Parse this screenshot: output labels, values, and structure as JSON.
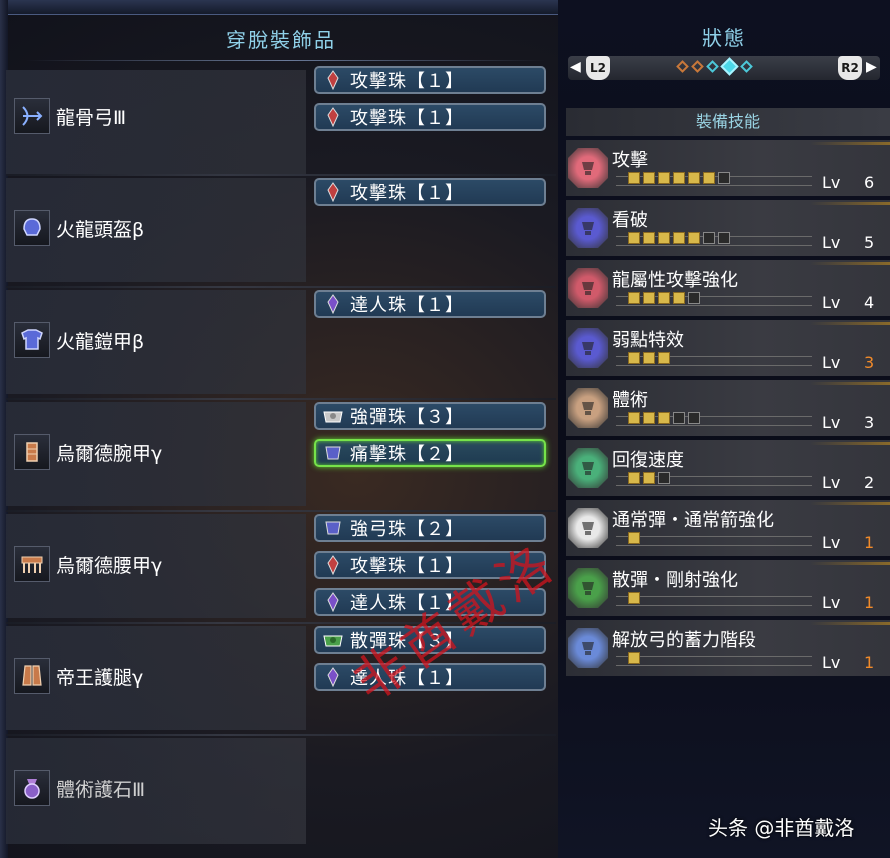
{
  "left_title": "穿脫裝飾品",
  "right_title": "狀態",
  "nav": {
    "left_button": "L2",
    "right_button": "R2",
    "left_arrow": "◀",
    "right_arrow": "▶"
  },
  "skills_header": "裝備技能",
  "lv_label": "Lv",
  "equipment": [
    {
      "name": "龍骨弓Ⅲ",
      "icon": "bow-icon",
      "decorations": [
        "攻擊珠【１】",
        "攻擊珠【１】"
      ]
    },
    {
      "name": "火龍頭盔β",
      "icon": "helm-icon",
      "decorations": [
        "攻擊珠【１】"
      ]
    },
    {
      "name": "火龍鎧甲β",
      "icon": "chest-armor-icon",
      "decorations": [
        "達人珠【１】"
      ]
    },
    {
      "name": "烏爾德腕甲γ",
      "icon": "arm-armor-icon",
      "decorations": [
        "強彈珠【３】",
        "痛擊珠【２】"
      ]
    },
    {
      "name": "烏爾德腰甲γ",
      "icon": "waist-armor-icon",
      "decorations": [
        "強弓珠【２】",
        "攻擊珠【１】",
        "達人珠【１】"
      ]
    },
    {
      "name": "帝王護腿γ",
      "icon": "leg-armor-icon",
      "decorations": [
        "散彈珠【３】",
        "達人珠【１】"
      ]
    },
    {
      "name": "體術護石Ⅲ",
      "icon": "charm-icon",
      "decorations": []
    }
  ],
  "skills": [
    {
      "name": "攻擊",
      "level": "6",
      "max": 7,
      "color": "#e06a7a",
      "max_reached": false
    },
    {
      "name": "看破",
      "level": "5",
      "max": 7,
      "color": "#5a5ad0",
      "max_reached": false
    },
    {
      "name": "龍屬性攻擊強化",
      "level": "4",
      "max": 5,
      "color": "#d05a6a",
      "max_reached": false
    },
    {
      "name": "弱點特效",
      "level": "3",
      "max": 3,
      "color": "#5a5ad0",
      "max_reached": true
    },
    {
      "name": "體術",
      "level": "3",
      "max": 5,
      "color": "#c8a080",
      "max_reached": false
    },
    {
      "name": "回復速度",
      "level": "2",
      "max": 3,
      "color": "#4ab07a",
      "max_reached": false
    },
    {
      "name": "通常彈・通常箭強化",
      "level": "1",
      "max": 1,
      "color": "#e8e8e8",
      "max_reached": true
    },
    {
      "name": "散彈・剛射強化",
      "level": "1",
      "max": 1,
      "color": "#4aa04a",
      "max_reached": true
    },
    {
      "name": "解放弓的蓄力階段",
      "level": "1",
      "max": 1,
      "color": "#6a8ad8",
      "max_reached": true
    }
  ],
  "watermark": "非酋戴洛",
  "credit": "头条 @非酋戴洛"
}
